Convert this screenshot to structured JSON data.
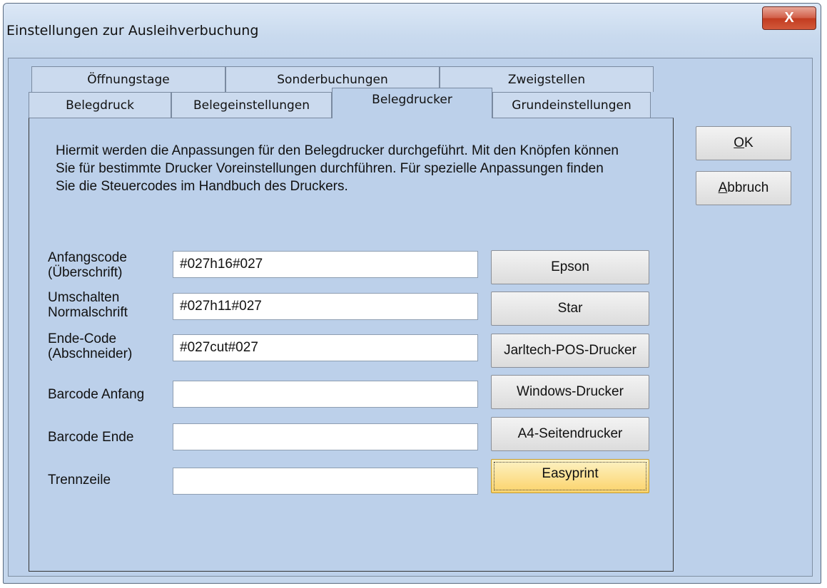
{
  "window": {
    "title": "Einstellungen zur Ausleihverbuchung",
    "close_glyph": "X"
  },
  "tabs": {
    "row1": [
      "Öffnungstage",
      "Sonderbuchungen",
      "Zweigstellen"
    ],
    "row2": [
      "Belegdruck",
      "Belegeinstellungen",
      "Belegdrucker",
      "Grundeinstellungen"
    ],
    "active": "Belegdrucker"
  },
  "panel": {
    "description": "Hiermit werden die Anpassungen für den Belegdrucker durchgeführt. Mit den Knöpfen können Sie für bestimmte Drucker Voreinstellungen durchführen. Für spezielle Anpassungen finden Sie die Steuercodes im Handbuch des Druckers.",
    "fields": [
      {
        "label_line1": "Anfangscode",
        "label_line2": "(Überschrift)",
        "value": "#027h16#027"
      },
      {
        "label_line1": "Umschalten",
        "label_line2": "Normalschrift",
        "value": "#027h11#027"
      },
      {
        "label_line1": "Ende-Code",
        "label_line2": "(Abschneider)",
        "value": "#027cut#027"
      },
      {
        "label_line1": "Barcode Anfang",
        "label_line2": "",
        "value": ""
      },
      {
        "label_line1": "Barcode Ende",
        "label_line2": "",
        "value": ""
      },
      {
        "label_line1": "Trennzeile",
        "label_line2": "",
        "value": ""
      }
    ],
    "printer_buttons": [
      "Epson",
      "Star",
      "Jarltech-POS-Drucker",
      "Windows-Drucker",
      "A4-Seitendrucker",
      "Easyprint"
    ]
  },
  "side_buttons": {
    "ok_mnemonic": "O",
    "ok_rest": "K",
    "cancel_mnemonic": "A",
    "cancel_rest": "bbruch"
  },
  "colors": {
    "dialog_bg": "#bcd0ea",
    "highlight_button": "#fbd36b",
    "close_button": "#c23c20"
  },
  "icons": {
    "close": "close-icon"
  }
}
